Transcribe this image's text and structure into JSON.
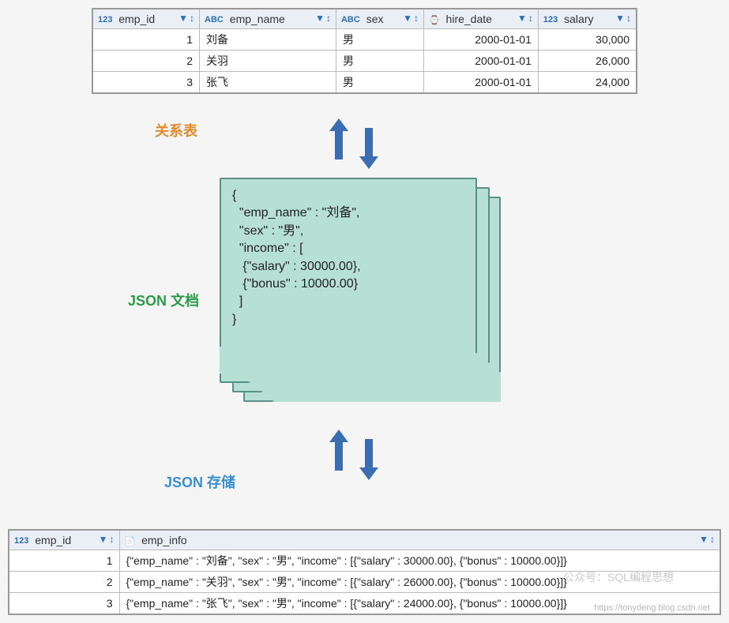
{
  "labels": {
    "relational_table": "关系表",
    "json_doc": "JSON 文档",
    "json_store": "JSON 存储"
  },
  "table1": {
    "columns": [
      {
        "type_label": "123",
        "name": "emp_id",
        "kind": "number"
      },
      {
        "type_label": "ABC",
        "name": "emp_name",
        "kind": "text"
      },
      {
        "type_label": "ABC",
        "name": "sex",
        "kind": "text"
      },
      {
        "type_label": "⌚",
        "name": "hire_date",
        "kind": "date"
      },
      {
        "type_label": "123",
        "name": "salary",
        "kind": "number"
      }
    ],
    "rows": [
      {
        "emp_id": "1",
        "emp_name": "刘备",
        "sex": "男",
        "hire_date": "2000-01-01",
        "salary": "30,000"
      },
      {
        "emp_id": "2",
        "emp_name": "关羽",
        "sex": "男",
        "hire_date": "2000-01-01",
        "salary": "26,000"
      },
      {
        "emp_id": "3",
        "emp_name": "张飞",
        "sex": "男",
        "hire_date": "2000-01-01",
        "salary": "24,000"
      }
    ]
  },
  "json_document_text": "{\n  \"emp_name\" : \"刘备\",\n  \"sex\" : \"男\",\n  \"income\" : [\n   {\"salary\" : 30000.00},\n   {\"bonus\" : 10000.00}\n  ]\n}",
  "table2": {
    "columns": [
      {
        "type_label": "123",
        "name": "emp_id",
        "kind": "number"
      },
      {
        "type_label": "📄",
        "name": "emp_info",
        "kind": "json"
      }
    ],
    "rows": [
      {
        "emp_id": "1",
        "emp_info": "{\"emp_name\" : \"刘备\", \"sex\" : \"男\", \"income\" : [{\"salary\" : 30000.00}, {\"bonus\" : 10000.00}]}"
      },
      {
        "emp_id": "2",
        "emp_info": "{\"emp_name\" : \"关羽\", \"sex\" : \"男\", \"income\" : [{\"salary\" : 26000.00}, {\"bonus\" : 10000.00}]}"
      },
      {
        "emp_id": "3",
        "emp_info": "{\"emp_name\" : \"张飞\", \"sex\" : \"男\", \"income\" : [{\"salary\" : 24000.00}, {\"bonus\" : 10000.00}]}"
      }
    ]
  },
  "watermark": {
    "source_line": "公众号：SQL编程思想",
    "url_line": "https://tonydeng.blog.csdn.net"
  }
}
